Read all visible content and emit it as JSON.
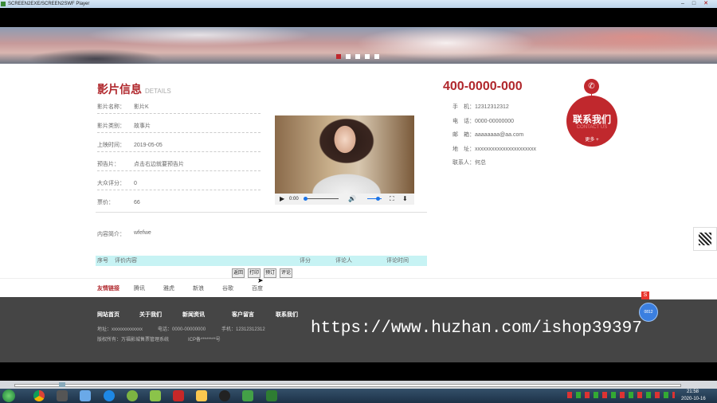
{
  "window": {
    "title": "SCREEN2EXE/SCREEN2SWF Player"
  },
  "film_info": {
    "heading": "影片信息",
    "heading_en": "DETAILS",
    "rows": [
      {
        "label": "影片名称：",
        "value": "影片K"
      },
      {
        "label": "影片类别：",
        "value": "故事片"
      },
      {
        "label": "上映时间：",
        "value": "2019-05-05"
      },
      {
        "label": "预告片：",
        "value": "点击右边就要预告片"
      },
      {
        "label": "大众评分：",
        "value": "0"
      },
      {
        "label": "票价：",
        "value": "66"
      }
    ],
    "intro_label": "内容简介：",
    "intro_value": "wfefwe"
  },
  "player": {
    "time": "0:00",
    "progress": 0,
    "volume": 0.7
  },
  "comments": {
    "headers": [
      "序号",
      "评价内容",
      "评分",
      "评论人",
      "评论时间"
    ],
    "buttons": [
      "返回",
      "打印",
      "预订",
      "评论"
    ]
  },
  "friend_links": {
    "label": "友情链接",
    "items": [
      "腾讯",
      "雅虎",
      "新浪",
      "谷歌",
      "百度"
    ]
  },
  "contact": {
    "phone_big": "400-0000-000",
    "rows": [
      {
        "label": "手　机：",
        "value": "12312312312"
      },
      {
        "label": "电　话：",
        "value": "0000-00000000"
      },
      {
        "label": "邮　箱：",
        "value": "aaaaaaaa@aa.com"
      },
      {
        "label": "地　址：",
        "value": "xxxxxxxxxxxxxxxxxxxxxx"
      },
      {
        "label": "联系人：",
        "value": "何总"
      }
    ],
    "badge_title": "联系我们",
    "badge_en": "CONTACT US",
    "badge_more": "更多 +"
  },
  "footer": {
    "nav": [
      "网站首页",
      "关于我们",
      "新闻资讯",
      "客户留言",
      "联系我们"
    ],
    "line1_address": "地址：xxxxxxxxxxxxx",
    "line1_phone": "电话：0000-00000000",
    "line1_mobile": "手机：12312312312",
    "line2_copyright": "版权所有：万福影城售票管理系统",
    "line2_icp": "ICP备********号"
  },
  "watermark": "https://www.huzhan.com/ishop39397",
  "taskbar": {
    "time": "21:58",
    "date": "2020-10-16"
  },
  "colors": {
    "accent_red": "#c0282d",
    "comment_bar": "#c7f3f4",
    "footer_bg": "#454545"
  }
}
